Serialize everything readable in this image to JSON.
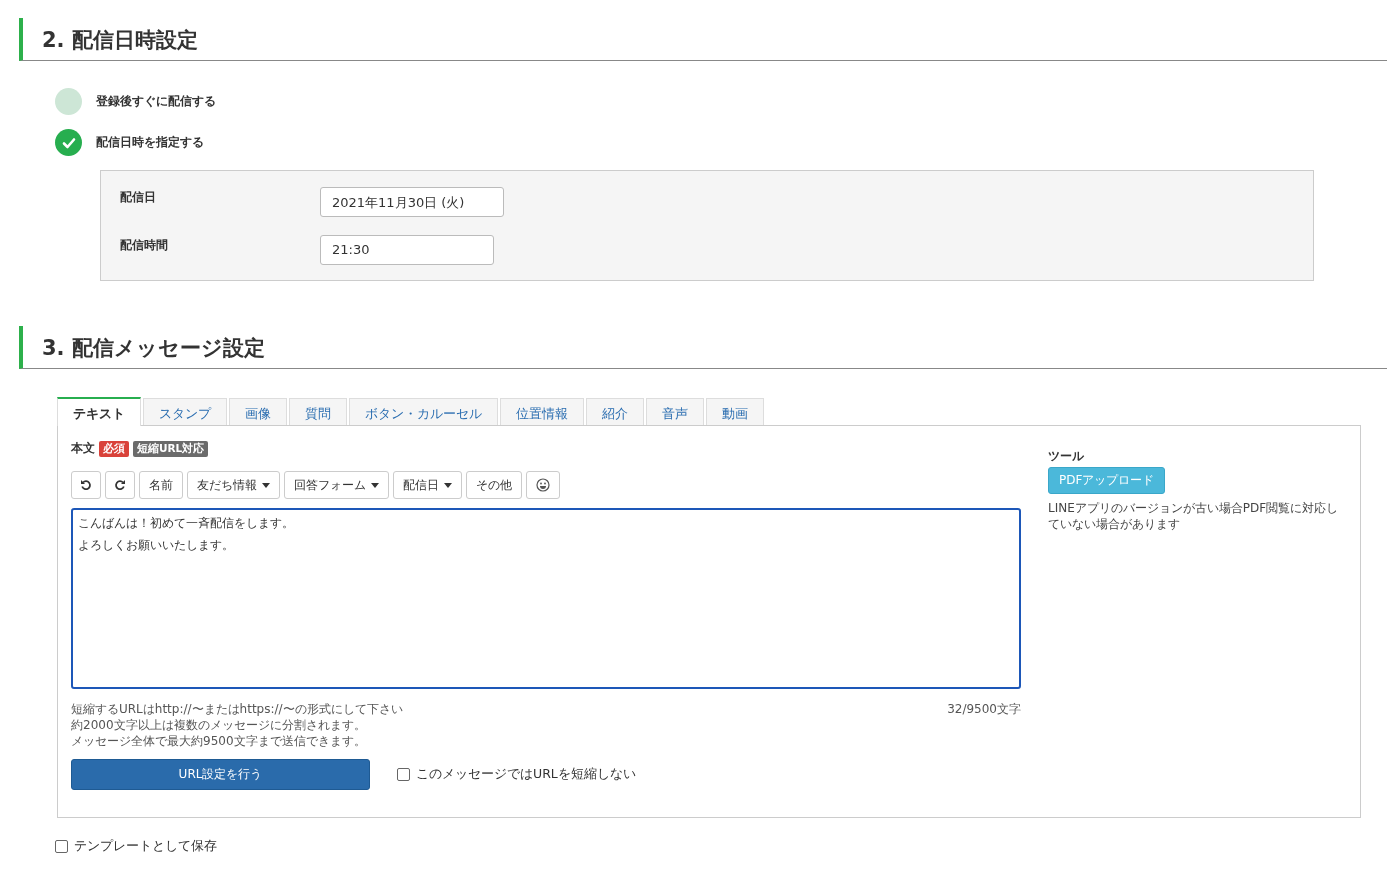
{
  "schedule_section": {
    "title": "2. 配信日時設定",
    "options": [
      {
        "label": "登録後すぐに配信する",
        "selected": false
      },
      {
        "label": "配信日時を指定する",
        "selected": true
      }
    ],
    "fields": [
      {
        "label": "配信日",
        "value": "2021年11月30日 (火)"
      },
      {
        "label": "配信時間",
        "value": "21:30"
      }
    ]
  },
  "message_section": {
    "title": "3. 配信メッセージ設定",
    "tabs": [
      {
        "label": "テキスト",
        "selected": true
      },
      {
        "label": "スタンプ",
        "selected": false
      },
      {
        "label": "画像",
        "selected": false
      },
      {
        "label": "質問",
        "selected": false
      },
      {
        "label": "ボタン・カルーセル",
        "selected": false
      },
      {
        "label": "位置情報",
        "selected": false
      },
      {
        "label": "紹介",
        "selected": false
      },
      {
        "label": "音声",
        "selected": false
      },
      {
        "label": "動画",
        "selected": false
      }
    ],
    "body_label": "本文",
    "badges": [
      {
        "label": "必須",
        "color": "#d9423a"
      },
      {
        "label": "短縮URL対応",
        "color": "#6b6b6b"
      }
    ],
    "toolbar": [
      {
        "kind": "undo"
      },
      {
        "kind": "redo"
      },
      {
        "kind": "text",
        "label": "名前"
      },
      {
        "kind": "dropdown",
        "label": "友だち情報"
      },
      {
        "kind": "dropdown",
        "label": "回答フォーム"
      },
      {
        "kind": "dropdown",
        "label": "配信日"
      },
      {
        "kind": "text",
        "label": "その他"
      },
      {
        "kind": "emoji"
      }
    ],
    "message_lines": [
      "こんばんは！初めて一斉配信をします。",
      "よろしくお願いいたします。"
    ],
    "help_lines": [
      "短縮するURLはhttp://〜またはhttps://〜の形式にして下さい",
      "約2000文字以上は複数のメッセージに分割されます。",
      "メッセージ全体で最大約9500文字まで送信できます。"
    ],
    "counter": "32/9500文字",
    "url_button": "URL設定を行う",
    "no_shorten": {
      "label": "このメッセージではURLを短縮しない",
      "checked": false
    },
    "tools": {
      "title": "ツール",
      "button": "PDFアップロード",
      "note": "LINEアプリのバージョンが古い場合PDF閲覧に対応していない場合があります"
    }
  },
  "save_template": {
    "label": "テンプレートとして保存",
    "checked": false
  }
}
